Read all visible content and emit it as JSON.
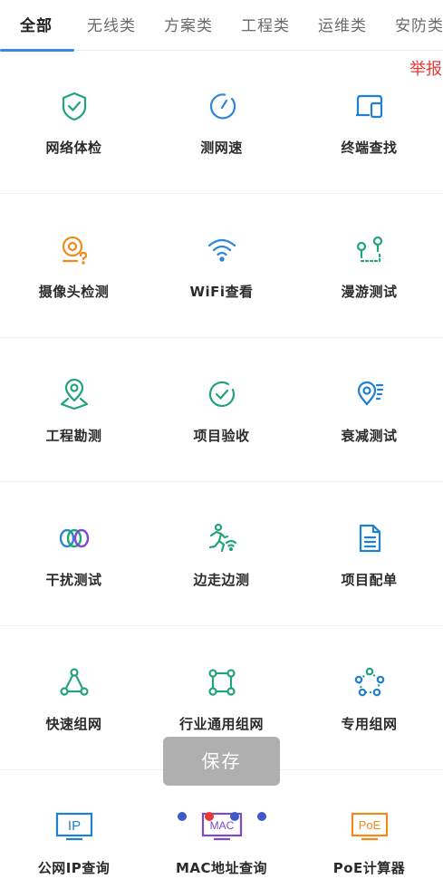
{
  "tabs": [
    {
      "label": "全部",
      "active": true
    },
    {
      "label": "无线类",
      "active": false
    },
    {
      "label": "方案类",
      "active": false
    },
    {
      "label": "工程类",
      "active": false
    },
    {
      "label": "运维类",
      "active": false
    },
    {
      "label": "安防类",
      "active": false
    }
  ],
  "report_link": "举报",
  "tools": [
    [
      {
        "label": "网络体检",
        "icon": "shield-check-icon",
        "color": "#23a37a"
      },
      {
        "label": "测网速",
        "icon": "speed-gauge-icon",
        "color": "#2f86d6"
      },
      {
        "label": "终端查找",
        "icon": "devices-icon",
        "color": "#1f7fd0"
      }
    ],
    [
      {
        "label": "摄像头检测",
        "icon": "camera-question-icon",
        "color": "#f08a1e"
      },
      {
        "label": "WiFi查看",
        "icon": "wifi-icon",
        "color": "#2f86d6"
      },
      {
        "label": "漫游测试",
        "icon": "roaming-path-icon",
        "color": "#23a37a"
      }
    ],
    [
      {
        "label": "工程勘测",
        "icon": "map-pin-icon",
        "color": "#23a37a"
      },
      {
        "label": "项目验收",
        "icon": "check-circle-icon",
        "color": "#23a37a"
      },
      {
        "label": "衰减测试",
        "icon": "signal-pin-icon",
        "color": "#1f7fd0"
      }
    ],
    [
      {
        "label": "干扰测试",
        "icon": "interference-rings-icon",
        "color": "#23a37a"
      },
      {
        "label": "边走边测",
        "icon": "walking-wifi-icon",
        "color": "#23a37a"
      },
      {
        "label": "项目配单",
        "icon": "document-icon",
        "color": "#1f7fd0"
      }
    ],
    [
      {
        "label": "快速组网",
        "icon": "triangle-network-icon",
        "color": "#23a37a"
      },
      {
        "label": "行业通用组网",
        "icon": "square-network-icon",
        "color": "#23a37a"
      },
      {
        "label": "专用组网",
        "icon": "pentagon-network-icon",
        "color": "#1f7fd0"
      }
    ],
    [
      {
        "label": "公网IP查询",
        "icon": "ip-box-icon",
        "box_text": "IP",
        "color": "#1f7fd0"
      },
      {
        "label": "MAC地址查询",
        "icon": "mac-box-icon",
        "box_text": "MAC",
        "color": "#7b4bc9"
      },
      {
        "label": "PoE计算器",
        "icon": "poe-box-icon",
        "box_text": "PoE",
        "color": "#f08a1e"
      }
    ]
  ],
  "toast": {
    "text": "保存"
  },
  "dots": [
    {
      "color": "#3f5ac8"
    },
    {
      "color": "#e53935"
    },
    {
      "color": "#3f5ac8"
    },
    {
      "color": "#3f5ac8"
    }
  ]
}
